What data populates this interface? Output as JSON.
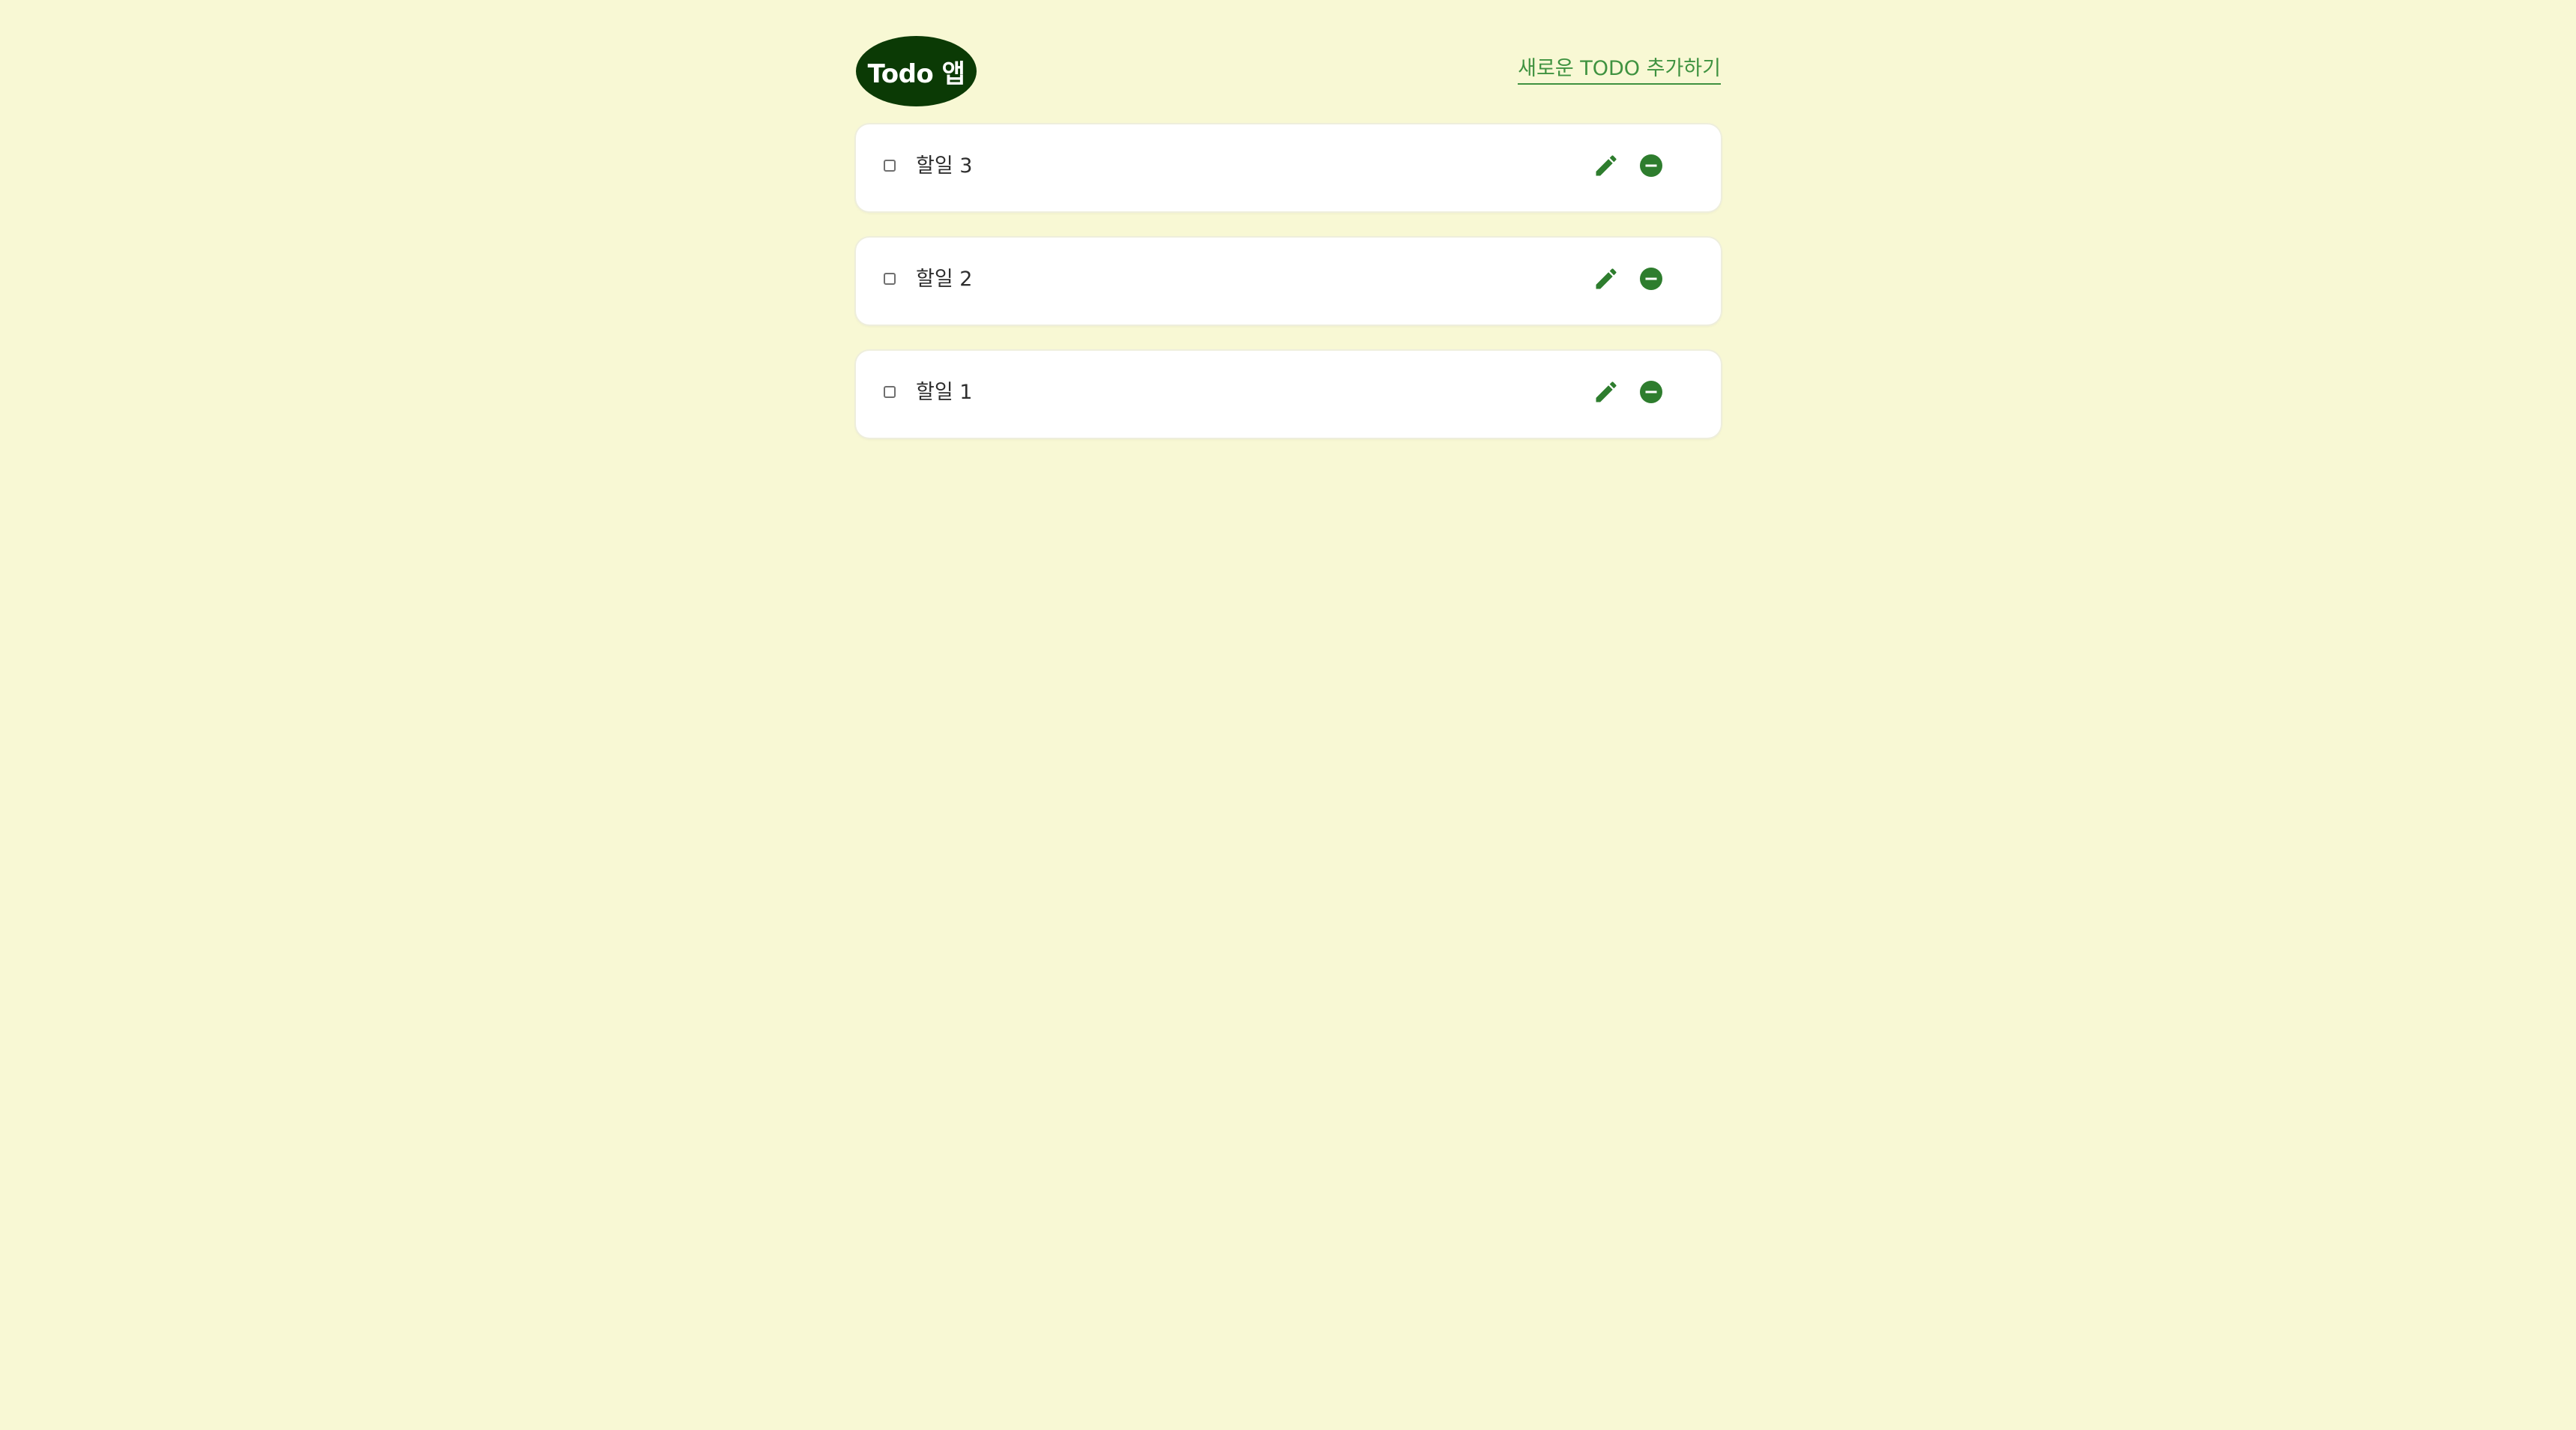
{
  "header": {
    "logo_text": "Todo 앱",
    "add_link_label": "새로운 TODO 추가하기"
  },
  "todos": [
    {
      "title": "할일 3",
      "done": false
    },
    {
      "title": "할일 2",
      "done": false
    },
    {
      "title": "할일 1",
      "done": false
    }
  ],
  "icons": {
    "edit": "pencil-icon",
    "remove": "minus-circle-icon"
  },
  "colors": {
    "background": "#f8f8d4",
    "logo_bg": "#0b3a05",
    "accent": "#3f9240",
    "icon": "#2e7d2e"
  }
}
